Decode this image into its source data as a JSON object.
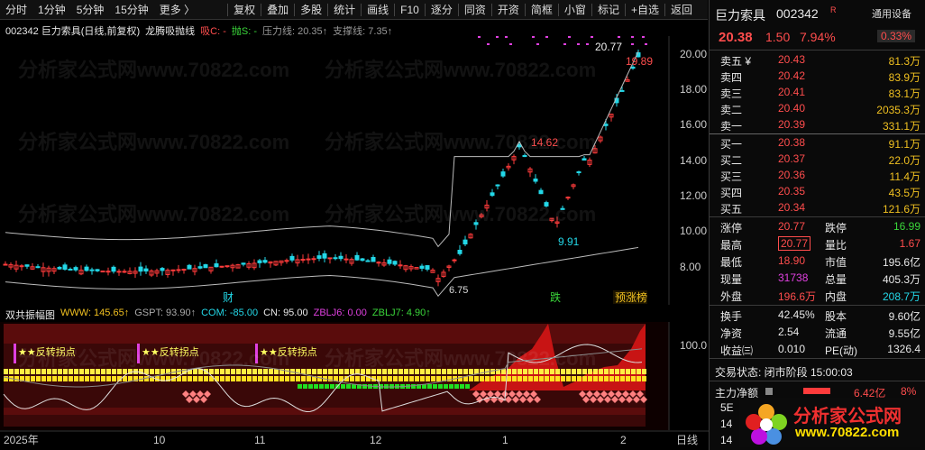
{
  "toolbar": {
    "left": [
      "分时",
      "1分钟",
      "5分钟",
      "15分钟",
      "更多 〉"
    ],
    "right": [
      "复权",
      "叠加",
      "多股",
      "统计",
      "画线",
      "F10",
      "逐分",
      "同资",
      "开资",
      "简框",
      "小窗",
      "标记",
      "+自选",
      "返回"
    ]
  },
  "kline_header": {
    "stock": "002342 巨力索具(日线,前复权)",
    "indicator": "龙腾吸抛线",
    "xi": "吸C: -",
    "pao": "抛S: -",
    "yali": "压力线: 20.35↑",
    "zhicheng": "支撑线: 7.35↑"
  },
  "price_axis": [
    "20.00",
    "18.00",
    "16.00",
    "14.00",
    "12.00",
    "10.00",
    "8.00"
  ],
  "price_annotations": {
    "high_peak": "20.77",
    "last_high": "19.89",
    "mid_high": "14.62",
    "mid_low": "9.91",
    "low": "6.75"
  },
  "event_labels": {
    "cai": "财",
    "die": "跌",
    "yuzhangting": "预涨榜"
  },
  "indicator_header": {
    "name": "双共振幅图",
    "www": "WWW: 145.65↑",
    "gspt": "GSPT: 93.90↑",
    "com": "COM: -85.00",
    "cn": "CN: 95.00",
    "zblj6": "ZBLJ6: 0.00",
    "zblj7": "ZBLJ7: 4.90↑"
  },
  "indicator_axis": "100.0",
  "signal_labels": [
    "★★反转拐点",
    "★★反转拐点",
    "★★反转拐点"
  ],
  "date_axis": [
    "2025年",
    "10",
    "11",
    "12",
    "1",
    "2"
  ],
  "date_axis_right": "日线",
  "watermark": "分析家公式网www.70822.com",
  "panel": {
    "name": "巨力索具",
    "code": "002342",
    "flag": "R",
    "device": "通用设备",
    "price": "20.38",
    "change": "1.50",
    "pct": "7.94%",
    "device_pct": "0.33%",
    "asks": [
      {
        "label": "卖五 ¥",
        "price": "20.43",
        "vol": "81.3万"
      },
      {
        "label": "卖四",
        "price": "20.42",
        "vol": "83.9万"
      },
      {
        "label": "卖三",
        "price": "20.41",
        "vol": "83.1万"
      },
      {
        "label": "卖二",
        "price": "20.40",
        "vol": "2035.3万"
      },
      {
        "label": "卖一",
        "price": "20.39",
        "vol": "331.1万"
      }
    ],
    "bids": [
      {
        "label": "买一",
        "price": "20.38",
        "vol": "91.1万"
      },
      {
        "label": "买二",
        "price": "20.37",
        "vol": "22.0万"
      },
      {
        "label": "买三",
        "price": "20.36",
        "vol": "11.4万"
      },
      {
        "label": "买四",
        "price": "20.35",
        "vol": "43.5万"
      },
      {
        "label": "买五",
        "price": "20.34",
        "vol": "121.6万"
      }
    ],
    "stats": [
      [
        "涨停",
        "20.77",
        "跌停",
        "16.99"
      ],
      [
        "最高",
        "20.77",
        "量比",
        "1.67"
      ],
      [
        "最低",
        "18.90",
        "市值",
        "195.6亿"
      ],
      [
        "现量",
        "31738",
        "总量",
        "405.3万"
      ],
      [
        "外盘",
        "196.6万",
        "内盘",
        "208.7万"
      ]
    ],
    "stats2": [
      [
        "换手",
        "42.45%",
        "股本",
        "9.60亿"
      ],
      [
        "净资",
        "2.54",
        "流通",
        "9.55亿"
      ],
      [
        "收益㈢",
        "0.010",
        "PE(动)",
        "1326.4"
      ]
    ],
    "trade_status": "交易状态: 闭市阶段 15:00:03",
    "main_net_label": "主力净额",
    "main_net_value": "6.42亿",
    "main_net_pct": "8%",
    "partial_left": [
      "5E",
      "14",
      "14"
    ],
    "logo_text": "分析家公式网",
    "logo_url": "www.70822.com"
  }
}
